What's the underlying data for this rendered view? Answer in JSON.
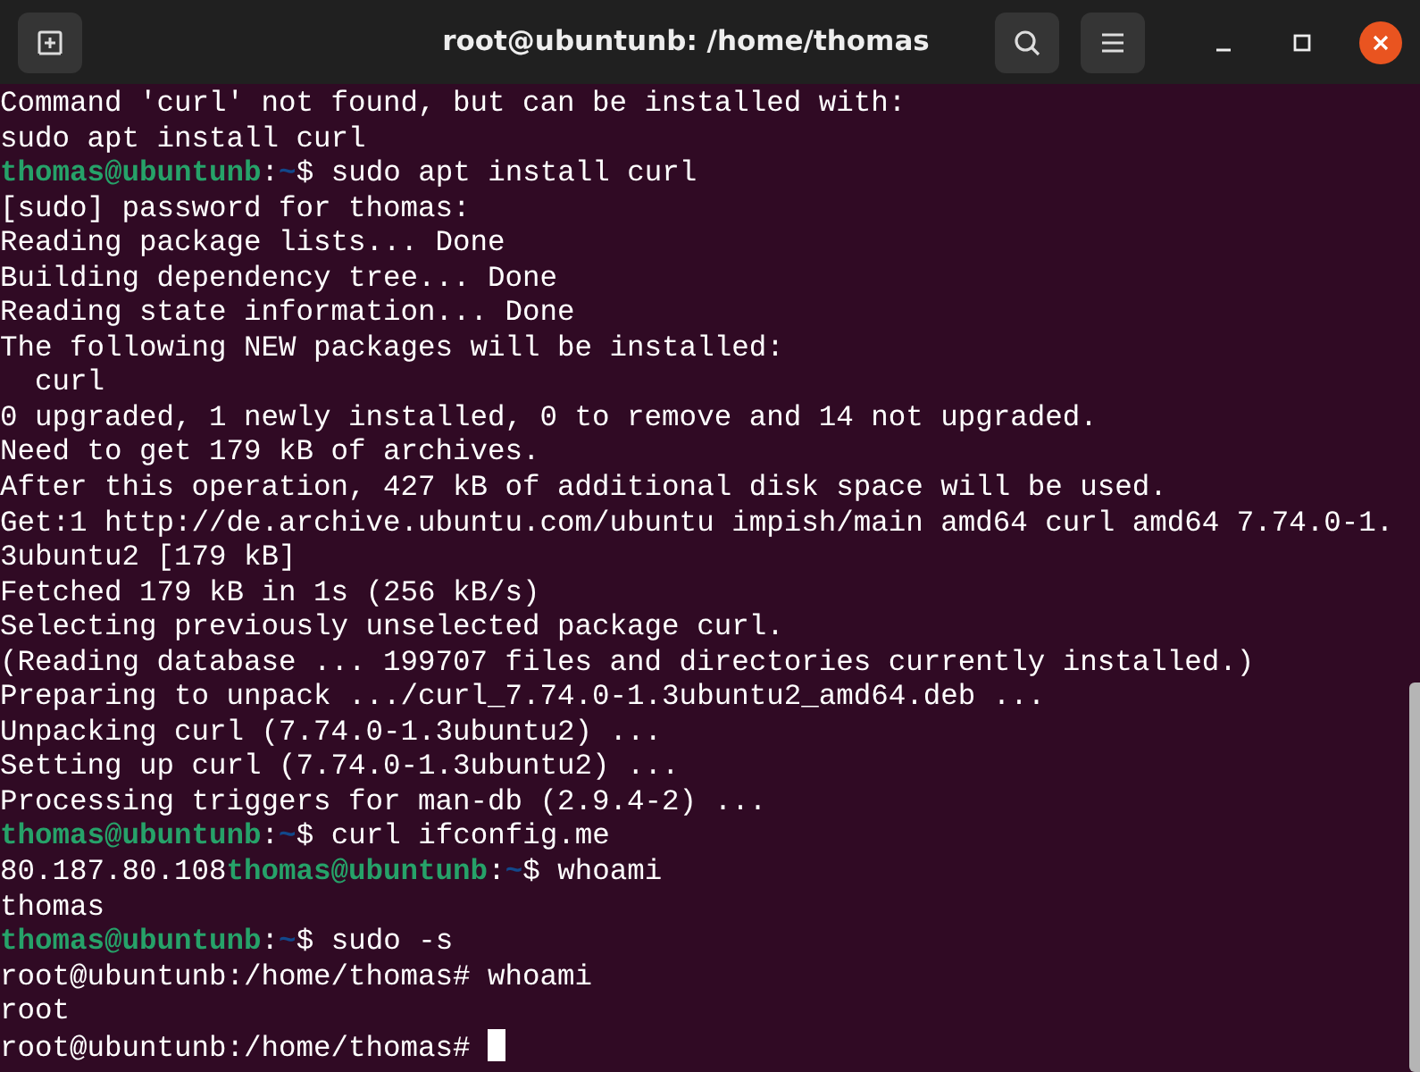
{
  "window": {
    "title": "root@ubuntunb: /home/thomas"
  },
  "terminal": {
    "lines": [
      [
        {
          "kind": "output",
          "text": "Command 'curl' not found, but can be installed with:"
        }
      ],
      [
        {
          "kind": "output",
          "text": "sudo apt install curl"
        }
      ],
      [
        {
          "kind": "user",
          "text": "thomas@ubuntunb"
        },
        {
          "kind": "output",
          "text": ":"
        },
        {
          "kind": "path",
          "text": "~"
        },
        {
          "kind": "output",
          "text": "$ sudo apt install curl"
        }
      ],
      [
        {
          "kind": "output",
          "text": "[sudo] password for thomas:"
        }
      ],
      [
        {
          "kind": "output",
          "text": "Reading package lists... Done"
        }
      ],
      [
        {
          "kind": "output",
          "text": "Building dependency tree... Done"
        }
      ],
      [
        {
          "kind": "output",
          "text": "Reading state information... Done"
        }
      ],
      [
        {
          "kind": "output",
          "text": "The following NEW packages will be installed:"
        }
      ],
      [
        {
          "kind": "output",
          "text": "  curl"
        }
      ],
      [
        {
          "kind": "output",
          "text": "0 upgraded, 1 newly installed, 0 to remove and 14 not upgraded."
        }
      ],
      [
        {
          "kind": "output",
          "text": "Need to get 179 kB of archives."
        }
      ],
      [
        {
          "kind": "output",
          "text": "After this operation, 427 kB of additional disk space will be used."
        }
      ],
      [
        {
          "kind": "output",
          "text": "Get:1 http://de.archive.ubuntu.com/ubuntu impish/main amd64 curl amd64 7.74.0-1."
        }
      ],
      [
        {
          "kind": "output",
          "text": "3ubuntu2 [179 kB]"
        }
      ],
      [
        {
          "kind": "output",
          "text": "Fetched 179 kB in 1s (256 kB/s)"
        }
      ],
      [
        {
          "kind": "output",
          "text": "Selecting previously unselected package curl."
        }
      ],
      [
        {
          "kind": "output",
          "text": "(Reading database ... 199707 files and directories currently installed.)"
        }
      ],
      [
        {
          "kind": "output",
          "text": "Preparing to unpack .../curl_7.74.0-1.3ubuntu2_amd64.deb ..."
        }
      ],
      [
        {
          "kind": "output",
          "text": "Unpacking curl (7.74.0-1.3ubuntu2) ..."
        }
      ],
      [
        {
          "kind": "output",
          "text": "Setting up curl (7.74.0-1.3ubuntu2) ..."
        }
      ],
      [
        {
          "kind": "output",
          "text": "Processing triggers for man-db (2.9.4-2) ..."
        }
      ],
      [
        {
          "kind": "user",
          "text": "thomas@ubuntunb"
        },
        {
          "kind": "output",
          "text": ":"
        },
        {
          "kind": "path",
          "text": "~"
        },
        {
          "kind": "output",
          "text": "$ curl ifconfig.me"
        }
      ],
      [
        {
          "kind": "output",
          "text": "80.187.80.108"
        },
        {
          "kind": "user",
          "text": "thomas@ubuntunb"
        },
        {
          "kind": "output",
          "text": ":"
        },
        {
          "kind": "path",
          "text": "~"
        },
        {
          "kind": "output",
          "text": "$ whoami"
        }
      ],
      [
        {
          "kind": "output",
          "text": "thomas"
        }
      ],
      [
        {
          "kind": "user",
          "text": "thomas@ubuntunb"
        },
        {
          "kind": "output",
          "text": ":"
        },
        {
          "kind": "path",
          "text": "~"
        },
        {
          "kind": "output",
          "text": "$ sudo -s"
        }
      ],
      [
        {
          "kind": "output",
          "text": "root@ubuntunb:/home/thomas# whoami"
        }
      ],
      [
        {
          "kind": "output",
          "text": "root"
        }
      ],
      [
        {
          "kind": "output",
          "text": "root@ubuntunb:/home/thomas# "
        },
        {
          "kind": "cursor"
        }
      ]
    ]
  }
}
